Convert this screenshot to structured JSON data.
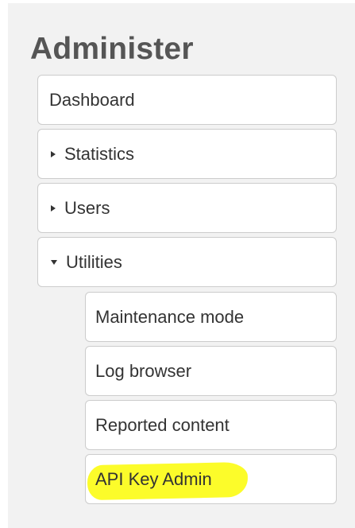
{
  "sidebar": {
    "title": "Administer",
    "items": [
      {
        "label": "Dashboard",
        "expander": "none"
      },
      {
        "label": "Statistics",
        "expander": "collapsed"
      },
      {
        "label": "Users",
        "expander": "collapsed"
      },
      {
        "label": "Utilities",
        "expander": "expanded"
      }
    ],
    "utilities_children": [
      {
        "label": "Maintenance mode"
      },
      {
        "label": "Log browser"
      },
      {
        "label": "Reported content"
      },
      {
        "label": "API Key Admin",
        "highlighted": true
      }
    ]
  },
  "colors": {
    "panel_background": "#f2f2f2",
    "title_text": "#555555",
    "item_text": "#333333",
    "item_border": "#cccccc",
    "highlight": "#fcfc2a"
  }
}
